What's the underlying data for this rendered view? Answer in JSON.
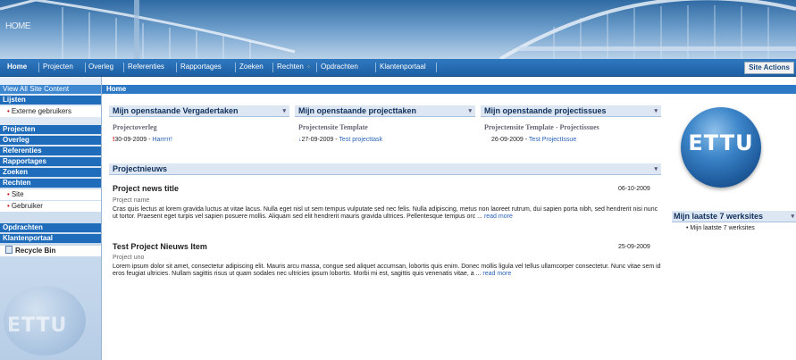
{
  "banner": {
    "title": "HOME"
  },
  "topnav": {
    "items": [
      "Home",
      "Projecten",
      "Overleg",
      "Referenties",
      "Rapportages",
      "Zoeken",
      "Rechten",
      "Opdrachten",
      "Klantenportaal"
    ],
    "site_actions": "Site Actions"
  },
  "leftnav": {
    "view_all": "View All Site Content",
    "lijsten": "Lijsten",
    "externe": "Externe gebruikers",
    "projecten": "Projecten",
    "overleg": "Overleg",
    "referenties": "Referenties",
    "rapportages": "Rapportages",
    "zoeken": "Zoeken",
    "rechten": "Rechten",
    "site": "Site",
    "gebruiker": "Gebruiker",
    "opdrachten": "Opdrachten",
    "klantenportaal": "Klantenportaal",
    "recycle": "Recycle Bin",
    "logo_text": "ETTU"
  },
  "main": {
    "head": "Home",
    "wp1": {
      "title": "Mijn openstaande Vergadertaken",
      "sub": "Projectoverleg",
      "date": "30-09-2009 -",
      "link": "Harrrrr!"
    },
    "wp2": {
      "title": "Mijn openstaande projecttaken",
      "sub": "Projectensite Template",
      "date": "27-09-2009 -",
      "link": "Test projecttask"
    },
    "wp3": {
      "title": "Mijn openstaande projectissues",
      "sub": "Projectensite Template - Projectissues",
      "date": "26-09-2009 -",
      "link": "Test ProjectIssue"
    },
    "news": {
      "title": "Projectnieuws",
      "items": [
        {
          "title": "Project news title",
          "date": "06-10-2009",
          "sub": "Project name",
          "body": "Cras quis lectus at lorem gravida luctus at vitae lacus. Nulla eget nisl ut sem tempus vulputate sed nec felis. Nulla adipiscing, metus non laoreet rutrum, dui sapien porta nibh, sed hendrerit nisi nunc ut tortor. Praesent eget turpis vel sapien posuere mollis. Aliquam sed elit hendrerit mauris gravida ultrices. Pellentesque tempus orc ...",
          "more": "read more"
        },
        {
          "title": "Test Project Nieuws Item",
          "date": "25-09-2009",
          "sub": "Project uno",
          "body": "Lorem ipsum dolor sit amet, consectetur adipiscing elit. Mauris arcu massa, congue sed aliquet accumsan, lobortis quis enim. Donec mollis ligula vel tellus ullamcorper consectetur. Nunc vitae sem id eros feugiat ultricies. Nullam sagittis risus ut quam sodales nec ultricies ipsum lobortis. Morbi mi est, sagittis quis venenatis vitae, a ...",
          "more": "read more"
        }
      ]
    }
  },
  "right": {
    "logo_text": "ETTU",
    "title": "Mijn laatste 7 werksites",
    "item": "Mijn laatste 7 werksites"
  }
}
